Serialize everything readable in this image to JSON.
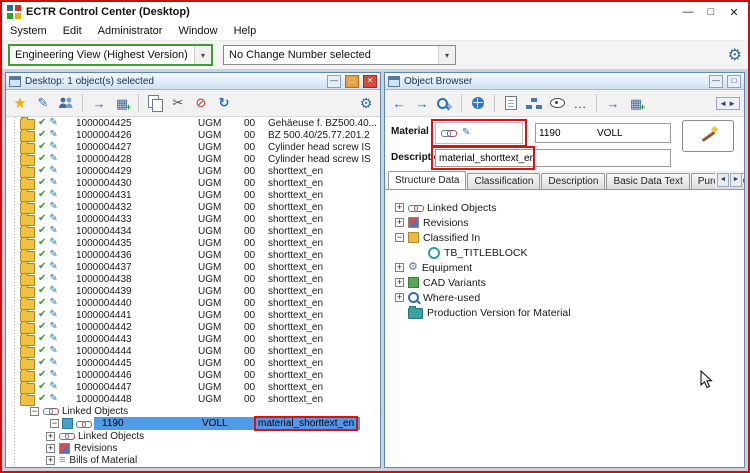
{
  "icons": {
    "minimize": "—",
    "maximize": "□",
    "close": "✕",
    "dropdown": "▾",
    "star": "★",
    "pencil": "✎",
    "arrow_right": "→",
    "arrow_left": "←",
    "grid": "▦",
    "scissors": "✂",
    "delete": "⊘",
    "refresh": "↻",
    "gear": "⚙",
    "ellipsis": "…",
    "check": "✔",
    "list": "≡",
    "tab_scroll_left": "◄",
    "tab_scroll_right": "►",
    "panel_toggle": "◄►",
    "scroll_up": "▲",
    "scroll_down": "▼"
  },
  "window": {
    "title": "ECTR Control Center (Desktop)"
  },
  "menubar": {
    "items": [
      "System",
      "Edit",
      "Administrator",
      "Window",
      "Help"
    ]
  },
  "main_toolbar": {
    "view_selector": "Engineering View (Highest Version)",
    "change_selector": "No Change Number selected"
  },
  "desktop_panel": {
    "title": "Desktop: 1 object(s) selected",
    "rows": [
      {
        "num": "1000004425",
        "mat": "UGM",
        "ver": "00",
        "desc": "Gehäeuse f. BZ500.40..."
      },
      {
        "num": "1000004426",
        "mat": "UGM",
        "ver": "00",
        "desc": "BZ 500.40/25.77.201.2"
      },
      {
        "num": "1000004427",
        "mat": "UGM",
        "ver": "00",
        "desc": "Cylinder head screw IS"
      },
      {
        "num": "1000004428",
        "mat": "UGM",
        "ver": "00",
        "desc": "Cylinder head screw IS"
      },
      {
        "num": "1000004429",
        "mat": "UGM",
        "ver": "00",
        "desc": "shorttext_en"
      },
      {
        "num": "1000004430",
        "mat": "UGM",
        "ver": "00",
        "desc": "shorttext_en"
      },
      {
        "num": "1000004431",
        "mat": "UGM",
        "ver": "00",
        "desc": "shorttext_en"
      },
      {
        "num": "1000004432",
        "mat": "UGM",
        "ver": "00",
        "desc": "shorttext_en"
      },
      {
        "num": "1000004433",
        "mat": "UGM",
        "ver": "00",
        "desc": "shorttext_en"
      },
      {
        "num": "1000004434",
        "mat": "UGM",
        "ver": "00",
        "desc": "shorttext_en"
      },
      {
        "num": "1000004435",
        "mat": "UGM",
        "ver": "00",
        "desc": "shorttext_en"
      },
      {
        "num": "1000004436",
        "mat": "UGM",
        "ver": "00",
        "desc": "shorttext_en"
      },
      {
        "num": "1000004437",
        "mat": "UGM",
        "ver": "00",
        "desc": "shorttext_en"
      },
      {
        "num": "1000004438",
        "mat": "UGM",
        "ver": "00",
        "desc": "shorttext_en"
      },
      {
        "num": "1000004439",
        "mat": "UGM",
        "ver": "00",
        "desc": "shorttext_en"
      },
      {
        "num": "1000004440",
        "mat": "UGM",
        "ver": "00",
        "desc": "shorttext_en"
      },
      {
        "num": "1000004441",
        "mat": "UGM",
        "ver": "00",
        "desc": "shorttext_en"
      },
      {
        "num": "1000004442",
        "mat": "UGM",
        "ver": "00",
        "desc": "shorttext_en"
      },
      {
        "num": "1000004443",
        "mat": "UGM",
        "ver": "00",
        "desc": "shorttext_en"
      },
      {
        "num": "1000004444",
        "mat": "UGM",
        "ver": "00",
        "desc": "shorttext_en"
      },
      {
        "num": "1000004445",
        "mat": "UGM",
        "ver": "00",
        "desc": "shorttext_en"
      },
      {
        "num": "1000004446",
        "mat": "UGM",
        "ver": "00",
        "desc": "shorttext_en"
      },
      {
        "num": "1000004447",
        "mat": "UGM",
        "ver": "00",
        "desc": "shorttext_en"
      },
      {
        "num": "1000004448",
        "mat": "UGM",
        "ver": "00",
        "desc": "shorttext_en"
      }
    ],
    "linked": {
      "label": "Linked Objects",
      "selected": {
        "num": "1190",
        "typ": "VOLL",
        "desc": "material_shorttext_en"
      },
      "children": [
        {
          "icon": "chain",
          "icon_name": "linked-objects-icon",
          "label": "Linked Objects"
        },
        {
          "icon": "ic-rev",
          "icon_name": "revisions-icon",
          "label": "Revisions"
        },
        {
          "icon": "ic-bom glyph",
          "icon_name": "bills-of-material-icon",
          "label": "Bills of Material"
        }
      ]
    }
  },
  "object_browser": {
    "title": "Object Browser",
    "material": {
      "label": "Material",
      "number": "1190",
      "type": "VOLL"
    },
    "description": {
      "label": "Description",
      "value": "material_shorttext_en"
    },
    "tabs": [
      {
        "label": "Structure Data",
        "cls": "active"
      },
      {
        "label": "Classification",
        "cls": ""
      },
      {
        "label": "Description",
        "cls": ""
      },
      {
        "label": "Basic Data Text",
        "cls": ""
      },
      {
        "label": "Purchase Order ...",
        "cls": ""
      }
    ],
    "tree": [
      {
        "expander": "+",
        "exp_class": "",
        "icon": "chain",
        "icon_name": "linked-objects-icon",
        "label": "Linked Objects",
        "indent_class": ""
      },
      {
        "expander": "+",
        "exp_class": "",
        "icon": "ic-rev",
        "icon_name": "revisions-icon",
        "label": "Revisions",
        "indent_class": ""
      },
      {
        "expander": "−",
        "exp_class": "",
        "icon": "ic-class",
        "icon_name": "classified-in-icon",
        "label": "Classified In",
        "indent_class": ""
      },
      {
        "expander": "",
        "exp_class": "leaf",
        "icon": "ic-classitem",
        "icon_name": "class-icon",
        "label": "TB_TITLEBLOCK",
        "indent_class": "indent-1"
      },
      {
        "expander": "+",
        "exp_class": "",
        "icon": "ic-equip gear-glyph",
        "icon_name": "equipment-icon",
        "label": "Equipment",
        "indent_class": ""
      },
      {
        "expander": "+",
        "exp_class": "",
        "icon": "ic-cad",
        "icon_name": "cad-variants-icon",
        "label": "CAD Variants",
        "indent_class": ""
      },
      {
        "expander": "+",
        "exp_class": "",
        "icon": "mag",
        "icon_name": "where-used-icon",
        "label": "Where-used",
        "indent_class": ""
      },
      {
        "expander": "",
        "exp_class": "leaf",
        "icon": "folder teal",
        "icon_name": "production-version-icon",
        "label": "Production Version for Material",
        "indent_class": ""
      }
    ]
  }
}
